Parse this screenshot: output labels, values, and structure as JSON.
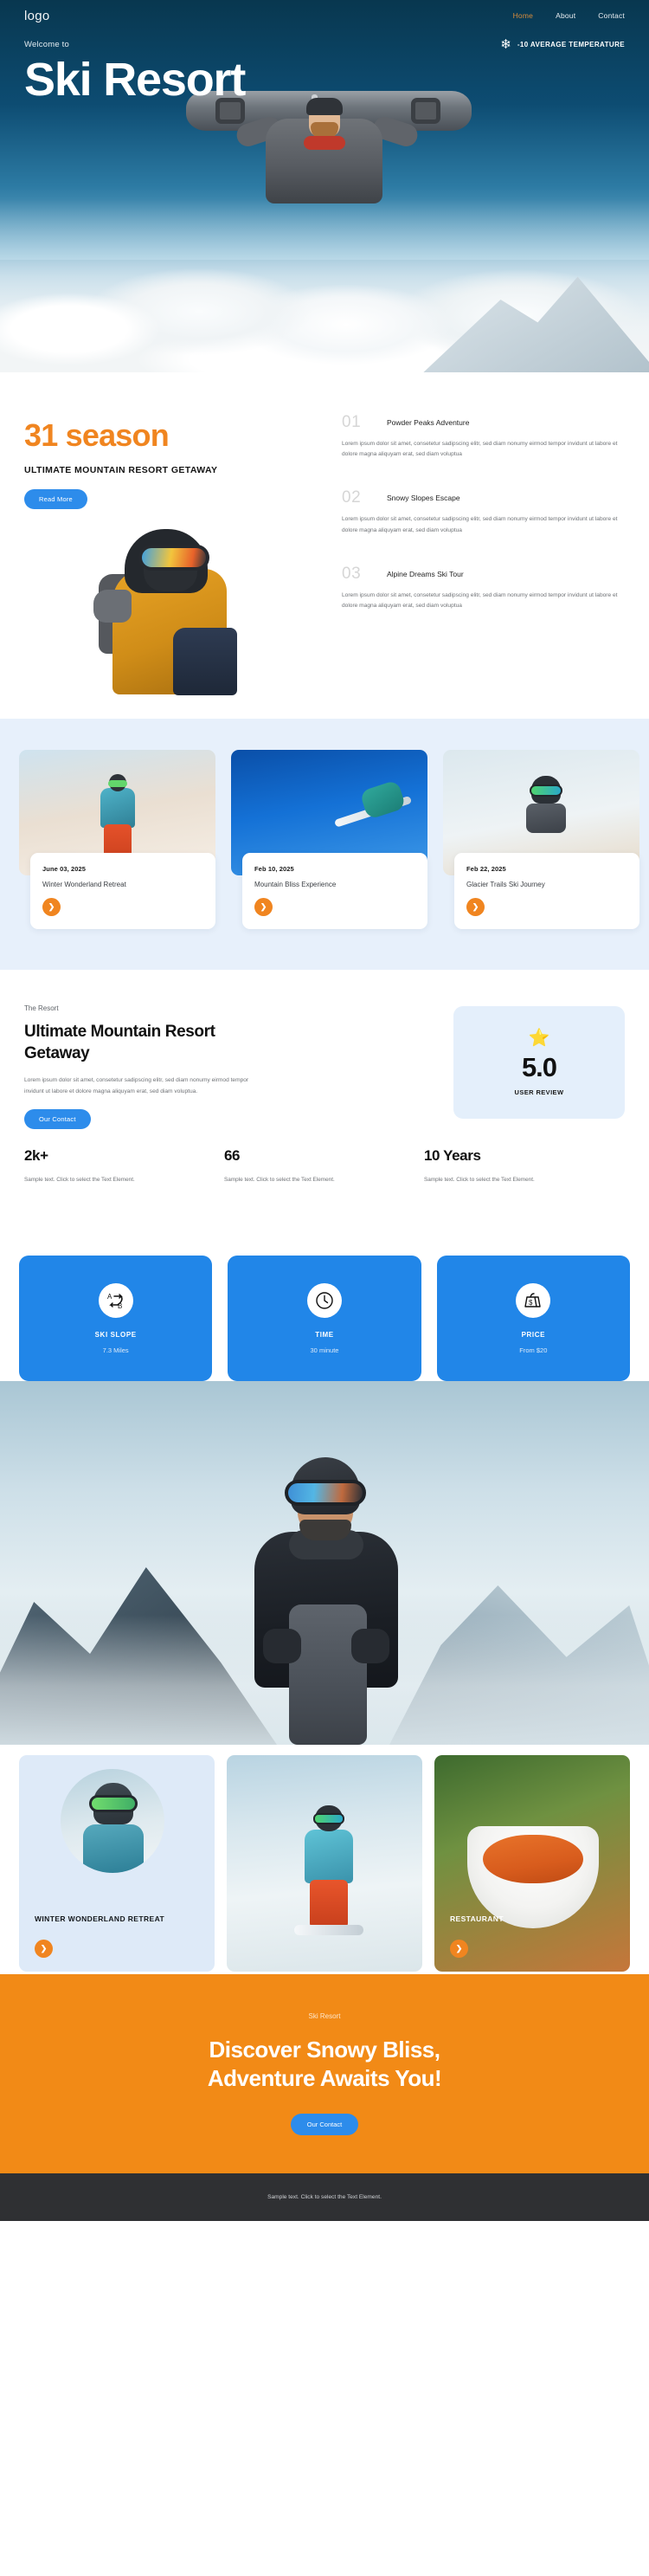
{
  "header": {
    "logo": "logo",
    "nav": [
      {
        "label": "Home",
        "active": true
      },
      {
        "label": "About",
        "active": false
      },
      {
        "label": "Contact",
        "active": false
      }
    ]
  },
  "hero": {
    "welcome": "Welcome to",
    "title": "Ski Resort",
    "snowflake_icon": "snowflake-icon",
    "temperature": "-10 AVERAGE TEMPERATURE"
  },
  "season": {
    "headline": "31 season",
    "subheadline": "ULTIMATE MOUNTAIN RESORT GETAWAY",
    "button": "Read More",
    "features": [
      {
        "number": "01",
        "title": "Powder Peaks Adventure",
        "body": "Lorem ipsum dolor sit amet, consetetur sadipscing elitr, sed diam nonumy eirmod tempor invidunt ut labore et dolore magna aliquyam erat, sed diam voluptua"
      },
      {
        "number": "02",
        "title": "Snowy Slopes Escape",
        "body": "Lorem ipsum dolor sit amet, consetetur sadipscing elitr, sed diam nonumy eirmod tempor invidunt ut labore et dolore magna aliquyam erat, sed diam voluptua"
      },
      {
        "number": "03",
        "title": "Alpine Dreams Ski Tour",
        "body": "Lorem ipsum dolor sit amet, consetetur sadipscing elitr, sed diam nonumy eirmod tempor invidunt ut labore et dolore magna aliquyam erat, sed diam voluptua"
      }
    ]
  },
  "events": [
    {
      "date": "June 03, 2025",
      "name": "Winter Wonderland Retreat",
      "arrow_icon": "arrow-right-icon"
    },
    {
      "date": "Feb 10, 2025",
      "name": "Mountain Bliss Experience",
      "arrow_icon": "arrow-right-icon"
    },
    {
      "date": "Feb 22, 2025",
      "name": "Glacier Trails Ski Journey",
      "arrow_icon": "arrow-right-icon"
    }
  ],
  "resort": {
    "eyebrow": "The Resort",
    "title": "Ultimate Mountain Resort Getaway",
    "body": "Lorem ipsum dolor sit amet, consetetur sadipscing elitr, sed diam nonumy eirmod tempor invidunt ut labore et dolore magna aliquyam erat, sed diam voluptua.",
    "button": "Our Contact",
    "review": {
      "star_icon": "star-icon",
      "score": "5.0",
      "label": "USER REVIEW"
    },
    "stats": [
      {
        "value": "2k+",
        "text": "Sample text. Click to select the Text Element."
      },
      {
        "value": "66",
        "text": "Sample text. Click to select the Text Element."
      },
      {
        "value": "10 Years",
        "text": "Sample text. Click to select the Text Element."
      }
    ]
  },
  "features": [
    {
      "icon": "route-a-to-b-icon",
      "name": "SKI SLOPE",
      "value": "7.3 Miles"
    },
    {
      "icon": "clock-icon",
      "name": "TIME",
      "value": "30 minute"
    },
    {
      "icon": "price-tag-icon",
      "name": "PRICE",
      "value": "From $20"
    }
  ],
  "gallery": [
    {
      "label": "WINTER WONDERLAND RETREAT",
      "arrow_icon": "arrow-right-icon"
    },
    {
      "label": "",
      "arrow_icon": "arrow-right-icon"
    },
    {
      "label": "RESTAURANT",
      "arrow_icon": "arrow-right-icon"
    }
  ],
  "cta": {
    "eyebrow": "Ski Resort",
    "title_line1": "Discover Snowy Bliss,",
    "title_line2": "Adventure Awaits You!",
    "button": "Our Contact"
  },
  "footer": {
    "text": "Sample text. Click to select the Text Element."
  },
  "colors": {
    "accent_orange": "#F08520",
    "accent_blue": "#2186E8",
    "cta_orange": "#F28A16",
    "hero_navy": "#0d4a6e",
    "light_blue_bg": "#E7F0FB",
    "footer_dark": "#2F3033"
  }
}
